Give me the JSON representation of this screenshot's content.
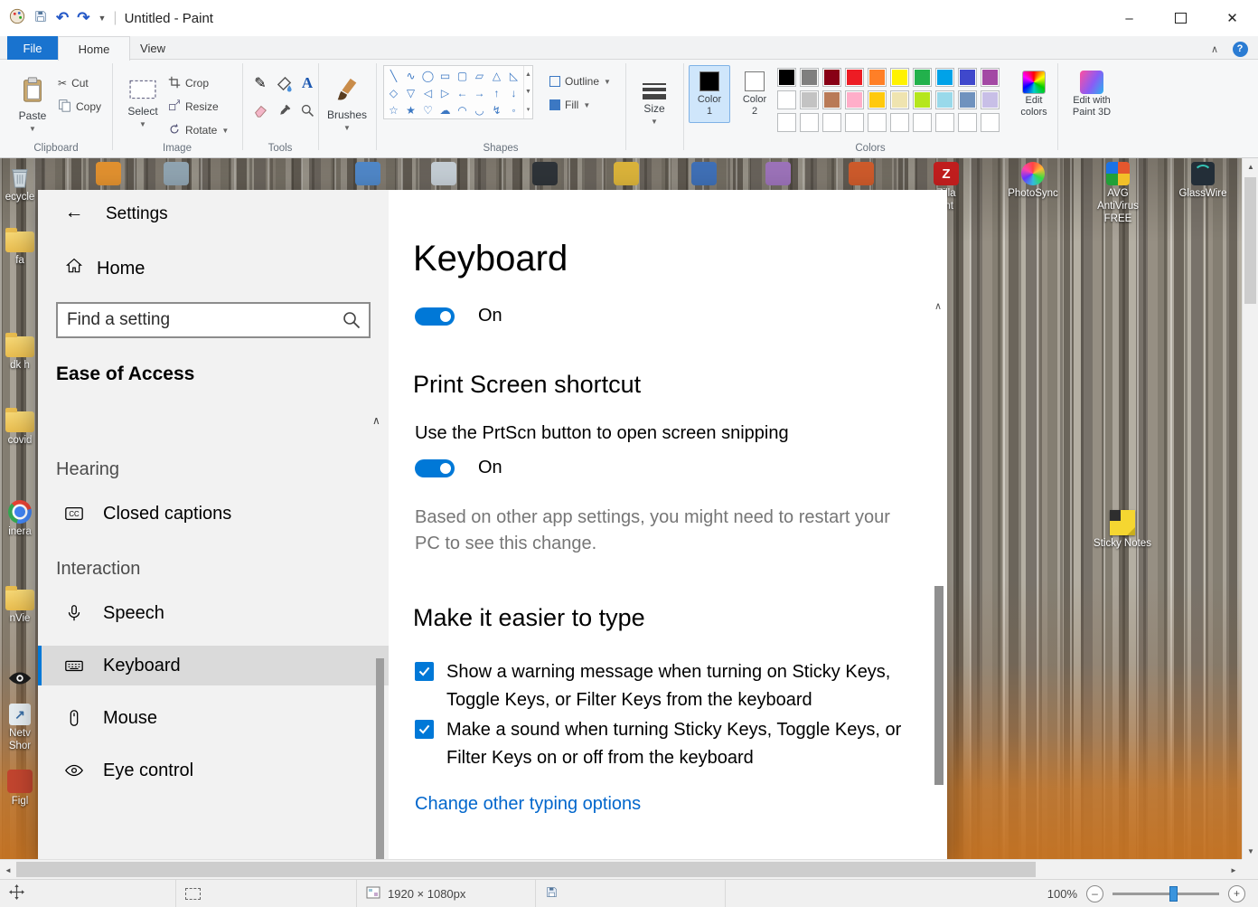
{
  "accent": "#0078d7",
  "link_color": "#0066cc",
  "paint": {
    "window_title": "Untitled - Paint",
    "tabs": {
      "file": "File",
      "home": "Home",
      "view": "View"
    },
    "clipboard": {
      "label": "Clipboard",
      "paste": "Paste",
      "cut": "Cut",
      "copy": "Copy"
    },
    "image_group": {
      "label": "Image",
      "select": "Select",
      "crop": "Crop",
      "resize": "Resize",
      "rotate": "Rotate"
    },
    "tools_label": "Tools",
    "brushes_label": "Brushes",
    "shapes_group": {
      "label": "Shapes",
      "outline": "Outline",
      "fill": "Fill",
      "glyphs": [
        "╲",
        "∿",
        "◯",
        "▭",
        "▢",
        "▱",
        "△",
        "◺",
        "◇",
        "▽",
        "◁",
        "▷",
        "←",
        "→",
        "↑",
        "↓",
        "☆",
        "★",
        "♡",
        "☁",
        "◠",
        "◡",
        "↯",
        "◦"
      ]
    },
    "size_label": "Size",
    "colors_group": {
      "label": "Colors",
      "color1_title": "Color",
      "color1_num": "1",
      "color2_title": "Color",
      "color2_num": "2",
      "color1_value": "#000000",
      "color2_value": "#ffffff",
      "edit_colors_line1": "Edit",
      "edit_colors_line2": "colors",
      "edit_3d_line1": "Edit with",
      "edit_3d_line2": "Paint 3D",
      "palette": [
        [
          "#000000",
          "#7f7f7f",
          "#880015",
          "#ed1c24",
          "#ff7f27",
          "#fff200",
          "#22b14c",
          "#00a2e8",
          "#3f48cc",
          "#a349a4"
        ],
        [
          "#ffffff",
          "#c3c3c3",
          "#b97a57",
          "#ffaec9",
          "#ffc90e",
          "#efe4b0",
          "#b5e61d",
          "#99d9ea",
          "#7092be",
          "#c8bfe7"
        ],
        [
          "#ffffff",
          "#ffffff",
          "#ffffff",
          "#ffffff",
          "#ffffff",
          "#ffffff",
          "#ffffff",
          "#ffffff",
          "#ffffff",
          "#ffffff"
        ]
      ]
    }
  },
  "settings": {
    "title": "Settings",
    "search_placeholder": "Find a setting",
    "nav_home": "Home",
    "nav_section": "Ease of Access",
    "nav_groups": [
      {
        "heading": "Hearing",
        "items": [
          {
            "label": "Closed captions",
            "icon": "closed-captions-icon"
          }
        ]
      },
      {
        "heading": "Interaction",
        "items": [
          {
            "label": "Speech",
            "icon": "microphone-icon"
          },
          {
            "label": "Keyboard",
            "icon": "keyboard-icon",
            "selected": true
          },
          {
            "label": "Mouse",
            "icon": "mouse-icon"
          },
          {
            "label": "Eye control",
            "icon": "eye-icon"
          }
        ]
      }
    ],
    "page": {
      "title": "Keyboard",
      "toggle_top": "On",
      "section_printscreen": "Print Screen shortcut",
      "printscreen_text": "Use the PrtScn button to open screen snipping",
      "toggle_prtscn": "On",
      "restart_note": "Based on other app settings, you might need to restart your PC to see this change.",
      "section_typing": "Make it easier to type",
      "checkbox_warning": "Show a warning message when turning on Sticky Keys, Toggle Keys, or Filter Keys from the keyboard",
      "checkbox_sound": "Make a sound when turning Sticky Keys, Toggle Keys, or Filter Keys on or off from the keyboard",
      "typing_link": "Change other typing options"
    }
  },
  "desktop": {
    "left_icons": [
      {
        "label": "ecycle",
        "icon": "recycle-bin-icon",
        "kind": "recycle"
      },
      {
        "label": "fa",
        "icon": "folder-icon",
        "kind": "folder"
      },
      {
        "label": "dk h",
        "icon": "folder-icon",
        "kind": "folder"
      },
      {
        "label": "covid",
        "icon": "folder-icon",
        "kind": "folder"
      },
      {
        "label": "inera",
        "icon": "chrome-icon",
        "kind": "chrome"
      },
      {
        "label": "nVie",
        "icon": "folder-icon",
        "kind": "folder"
      },
      {
        "label": "",
        "icon": "eye-app-icon",
        "kind": "eye"
      },
      {
        "label": "Netv\nShor",
        "icon": "shortcut-icon",
        "kind": "shortcut",
        "glyph": "↗"
      },
      {
        "label": "Figl",
        "icon": "app-icon",
        "kind": "plain",
        "color": "#c2452f"
      }
    ],
    "top_icons": [
      {
        "label": "",
        "icon": "app-icon",
        "kind": "plain",
        "color": "#e0902f"
      },
      {
        "label": "",
        "icon": "app-icon",
        "kind": "plain",
        "color": "#8fa3b0"
      },
      {
        "label": "",
        "icon": "app-icon",
        "kind": "plain",
        "color": "#4f86c6"
      },
      {
        "label": "",
        "icon": "app-icon",
        "kind": "plain",
        "color": "#c3ccd3"
      },
      {
        "label": "",
        "icon": "app-icon",
        "kind": "plain",
        "color": "#2e3338"
      },
      {
        "label": "",
        "icon": "app-icon",
        "kind": "plain",
        "color": "#d9b23a"
      },
      {
        "label": "",
        "icon": "app-icon",
        "kind": "plain",
        "color": "#3f6fb5"
      },
      {
        "label": "",
        "icon": "app-icon",
        "kind": "plain",
        "color": "#9b72b8"
      },
      {
        "label": "",
        "icon": "app-icon",
        "kind": "plain",
        "color": "#cc5a2b"
      },
      {
        "label": "Zilla\nent",
        "icon": "filezilla-icon",
        "kind": "plain",
        "color": "#c01e1e",
        "glyph": "Z"
      },
      {
        "label": "PhotoSync",
        "icon": "photosync-icon",
        "kind": "photosync"
      },
      {
        "label": "AVG AntiVirus\nFREE",
        "icon": "avg-antivirus-icon",
        "kind": "avg"
      },
      {
        "label": "GlassWire",
        "icon": "glasswire-icon",
        "kind": "glasswire"
      }
    ],
    "sticky_notes": {
      "label": "Sticky Notes"
    }
  },
  "statusbar": {
    "canvas_size": "1920 × 1080px",
    "zoom_level": "100%"
  }
}
